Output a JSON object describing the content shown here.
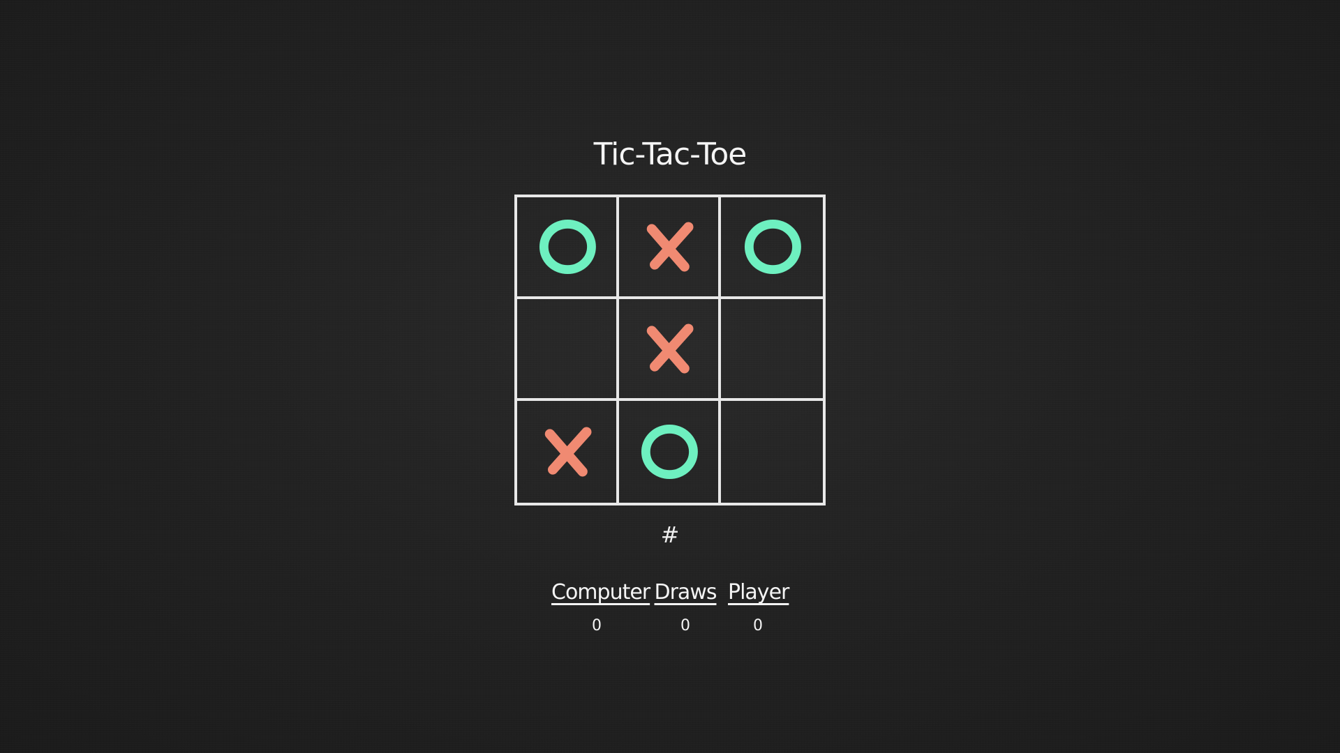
{
  "title": "Tic-Tac-Toe",
  "board": [
    [
      "O",
      "X",
      "O"
    ],
    [
      "",
      "X",
      ""
    ],
    [
      "X",
      "O",
      ""
    ]
  ],
  "reset_label": "#",
  "scoreboard": {
    "computer": {
      "label": "Computer",
      "value": "0"
    },
    "draws": {
      "label": "Draws",
      "value": "0"
    },
    "player": {
      "label": "Player",
      "value": "0"
    }
  },
  "colors": {
    "background": "#222222",
    "chalk": "#e8e8e8",
    "x_mark": "#f08a72",
    "o_mark": "#6ef0c0"
  }
}
